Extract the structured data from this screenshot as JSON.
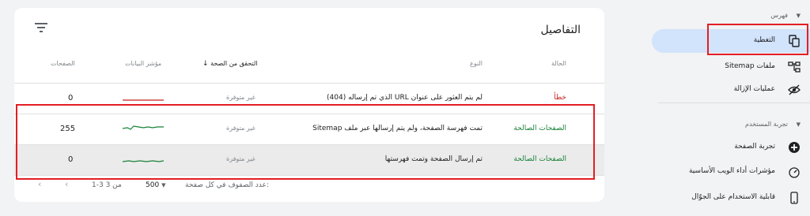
{
  "details": {
    "title": "التفاصيل",
    "columns": {
      "status": "الحالة",
      "type": "النوع",
      "validation": "التحقق من الصحة",
      "trend": "مؤشر البيانات",
      "pages": "الصفحات"
    },
    "rows": [
      {
        "status": "خطأ",
        "type": "لم يتم العثور على عنوان URL الذي تم إرساله (404)",
        "validation": "غير متوفرة",
        "pages": "0"
      },
      {
        "status": "الصفحات الصالحة",
        "type": "تمت فهرسة الصفحة، ولم يتم إرسالها عبر ملف Sitemap",
        "validation": "غير متوفرة",
        "pages": "255"
      },
      {
        "status": "الصفحات الصالحة",
        "type": "تم إرسال الصفحة وتمت فهرستها",
        "validation": "غير متوفرة",
        "pages": "0"
      }
    ],
    "pagination": {
      "rows_per_page_label": "عدد الصفوف في كل صفحة:",
      "rows_per_page_value": "500",
      "range": "1-3 من 3"
    }
  },
  "sidebar": {
    "index_section": "فهرس",
    "index_items": [
      {
        "label": "التغطية",
        "icon": "coverage-icon"
      },
      {
        "label": "ملفات Sitemap",
        "icon": "sitemap-icon"
      },
      {
        "label": "عمليات الإزالة",
        "icon": "removals-icon"
      }
    ],
    "experience_section": "تجربة المستخدم",
    "experience_items": [
      {
        "label": "تجربة الصفحة",
        "icon": "page-experience-icon"
      },
      {
        "label": "مؤشرات أداء الويب الأساسية",
        "icon": "core-web-vitals-icon"
      },
      {
        "label": "قابلية الاستخدام على الجوّال",
        "icon": "mobile-usability-icon"
      }
    ]
  },
  "colors": {
    "error": "#c5221f",
    "valid": "#188038",
    "highlight": "#e31e24",
    "active_nav": "#d2e3fc"
  }
}
